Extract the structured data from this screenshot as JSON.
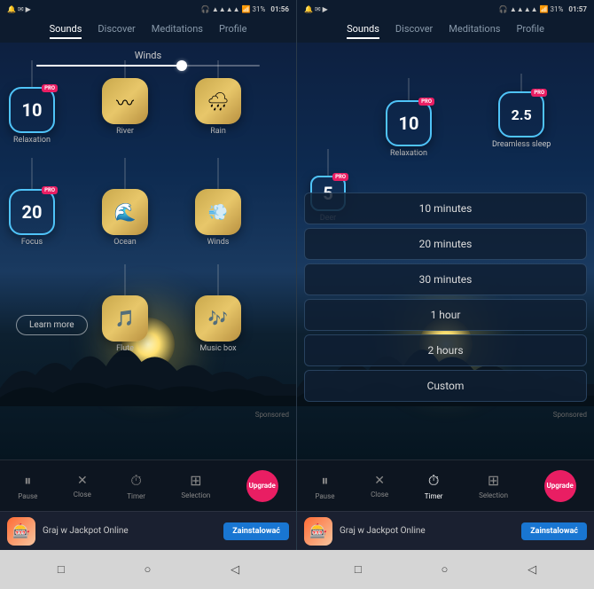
{
  "left_phone": {
    "status_bar": {
      "time": "01:56",
      "battery": "31%"
    },
    "nav_tabs": [
      {
        "label": "Sounds",
        "active": true
      },
      {
        "label": "Discover",
        "active": false
      },
      {
        "label": "Meditations",
        "active": false
      },
      {
        "label": "Profile",
        "active": false
      }
    ],
    "slider": {
      "label": "Winds"
    },
    "sounds": [
      {
        "id": "relaxation",
        "number": "10",
        "label": "Relaxation",
        "type": "number",
        "pro": true
      },
      {
        "id": "river",
        "icon": "≋",
        "label": "River",
        "type": "gold"
      },
      {
        "id": "rain",
        "icon": "☁",
        "label": "Rain",
        "type": "gold"
      },
      {
        "id": "focus",
        "number": "20",
        "label": "Focus",
        "type": "number",
        "pro": true
      },
      {
        "id": "ocean",
        "icon": "☀",
        "label": "Ocean",
        "type": "gold"
      },
      {
        "id": "winds",
        "icon": "≈",
        "label": "Winds",
        "type": "gold"
      },
      {
        "id": "flute",
        "icon": "♩♩",
        "label": "Flute",
        "type": "gold"
      },
      {
        "id": "musicbox",
        "icon": "♪",
        "label": "Music box",
        "type": "gold"
      }
    ],
    "learn_more": "Learn more",
    "bottom_bar": {
      "items": [
        {
          "label": "Pause",
          "icon": "⏸"
        },
        {
          "label": "Close",
          "icon": "✕"
        },
        {
          "label": "Timer",
          "icon": "⏱"
        },
        {
          "label": "Selection",
          "icon": "⊞"
        },
        {
          "label": "Upgrade",
          "type": "pro"
        }
      ]
    },
    "ad": {
      "sponsored": "Sponsored",
      "text": "Graj w Jackpot Online",
      "install": "Zainstalować"
    }
  },
  "right_phone": {
    "status_bar": {
      "time": "01:57",
      "battery": "31%"
    },
    "nav_tabs": [
      {
        "label": "Sounds",
        "active": true
      },
      {
        "label": "Discover",
        "active": false
      },
      {
        "label": "Meditations",
        "active": false
      },
      {
        "label": "Profile",
        "active": false
      }
    ],
    "sounds": [
      {
        "id": "relaxation",
        "number": "10",
        "label": "Relaxation",
        "type": "number",
        "pro": true
      },
      {
        "id": "dreamless",
        "number": "2.5",
        "label": "Dreamless sleep",
        "type": "number",
        "pro": true
      },
      {
        "id": "deer",
        "number": "5",
        "label": "Deer",
        "type": "number",
        "pro": true
      }
    ],
    "timer_options": [
      {
        "label": "10 minutes"
      },
      {
        "label": "20 minutes"
      },
      {
        "label": "30 minutes"
      },
      {
        "label": "1 hour"
      },
      {
        "label": "2 hours"
      },
      {
        "label": "Custom"
      }
    ],
    "bottom_bar": {
      "items": [
        {
          "label": "Pause",
          "icon": "⏸"
        },
        {
          "label": "Close",
          "icon": "✕"
        },
        {
          "label": "Timer",
          "icon": "⏱",
          "active": true
        },
        {
          "label": "Selection",
          "icon": "⊞"
        },
        {
          "label": "Upgrade",
          "type": "pro"
        }
      ]
    },
    "ad": {
      "sponsored": "Sponsored",
      "text": "Graj w Jackpot Online",
      "install": "Zainstalować"
    }
  },
  "home_bar": {
    "buttons": [
      "□",
      "○",
      "◁"
    ]
  }
}
